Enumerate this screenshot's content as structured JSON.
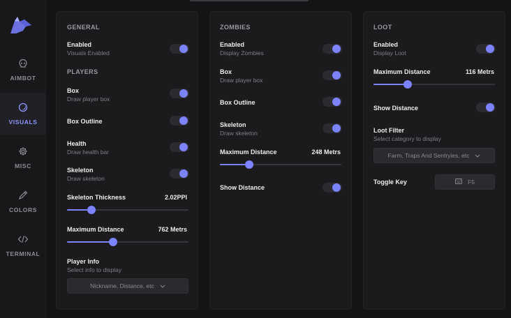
{
  "sidebar": {
    "items": [
      {
        "label": "AIMBOT",
        "icon": "skull-icon"
      },
      {
        "label": "VISUALS",
        "icon": "crescent-icon",
        "active": true
      },
      {
        "label": "MISC",
        "icon": "gear-icon"
      },
      {
        "label": "COLORS",
        "icon": "eyedropper-icon"
      },
      {
        "label": "TERMINAL",
        "icon": "code-icon"
      }
    ]
  },
  "general": {
    "title": "GENERAL",
    "enabled": {
      "title": "Enabled",
      "sub": "Visuals Enabled",
      "on": true
    }
  },
  "players": {
    "title": "PLAYERS",
    "box": {
      "title": "Box",
      "sub": "Draw player box",
      "on": true
    },
    "box_outline": {
      "title": "Box Outline",
      "on": true
    },
    "health": {
      "title": "Health",
      "sub": "Draw health bar",
      "on": true
    },
    "skeleton": {
      "title": "Skeleton",
      "sub": "Draw skeleton",
      "on": true
    },
    "skeleton_thickness": {
      "title": "Skeleton Thickness",
      "value_text": "2.02PPI",
      "fraction": 0.2
    },
    "max_distance": {
      "title": "Maximum Distance",
      "value_text": "762 Metrs",
      "fraction": 0.38
    },
    "player_info": {
      "title": "Player Info",
      "sub": "Select info to display",
      "select_text": "Nickname, Distance, etc"
    }
  },
  "zombies": {
    "title": "ZOMBIES",
    "enabled": {
      "title": "Enabled",
      "sub": "Display Zombies",
      "on": true
    },
    "box": {
      "title": "Box",
      "sub": "Draw player box",
      "on": true
    },
    "box_outline": {
      "title": "Box Outline",
      "on": true
    },
    "skeleton": {
      "title": "Skeleton",
      "sub": "Draw skeleton",
      "on": true
    },
    "max_distance": {
      "title": "Maximum Distance",
      "value_text": "248 Metrs",
      "fraction": 0.24
    },
    "show_distance": {
      "title": "Show Distance",
      "on": true
    }
  },
  "loot": {
    "title": "LOOT",
    "enabled": {
      "title": "Enabled",
      "sub": "Display Loot",
      "on": true
    },
    "max_distance": {
      "title": "Maximum Distance",
      "value_text": "116 Metrs",
      "fraction": 0.28
    },
    "show_distance": {
      "title": "Show Distance",
      "on": true
    },
    "loot_filter": {
      "title": "Loot Filter",
      "sub": "Select category to display",
      "select_text": "Farm, Traps And Sentryies, etc"
    },
    "toggle_key": {
      "title": "Toggle Key",
      "key": "F5"
    }
  },
  "colors": {
    "accent": "#7b83ff",
    "panel": "#1b1b1e",
    "background": "#141416"
  }
}
